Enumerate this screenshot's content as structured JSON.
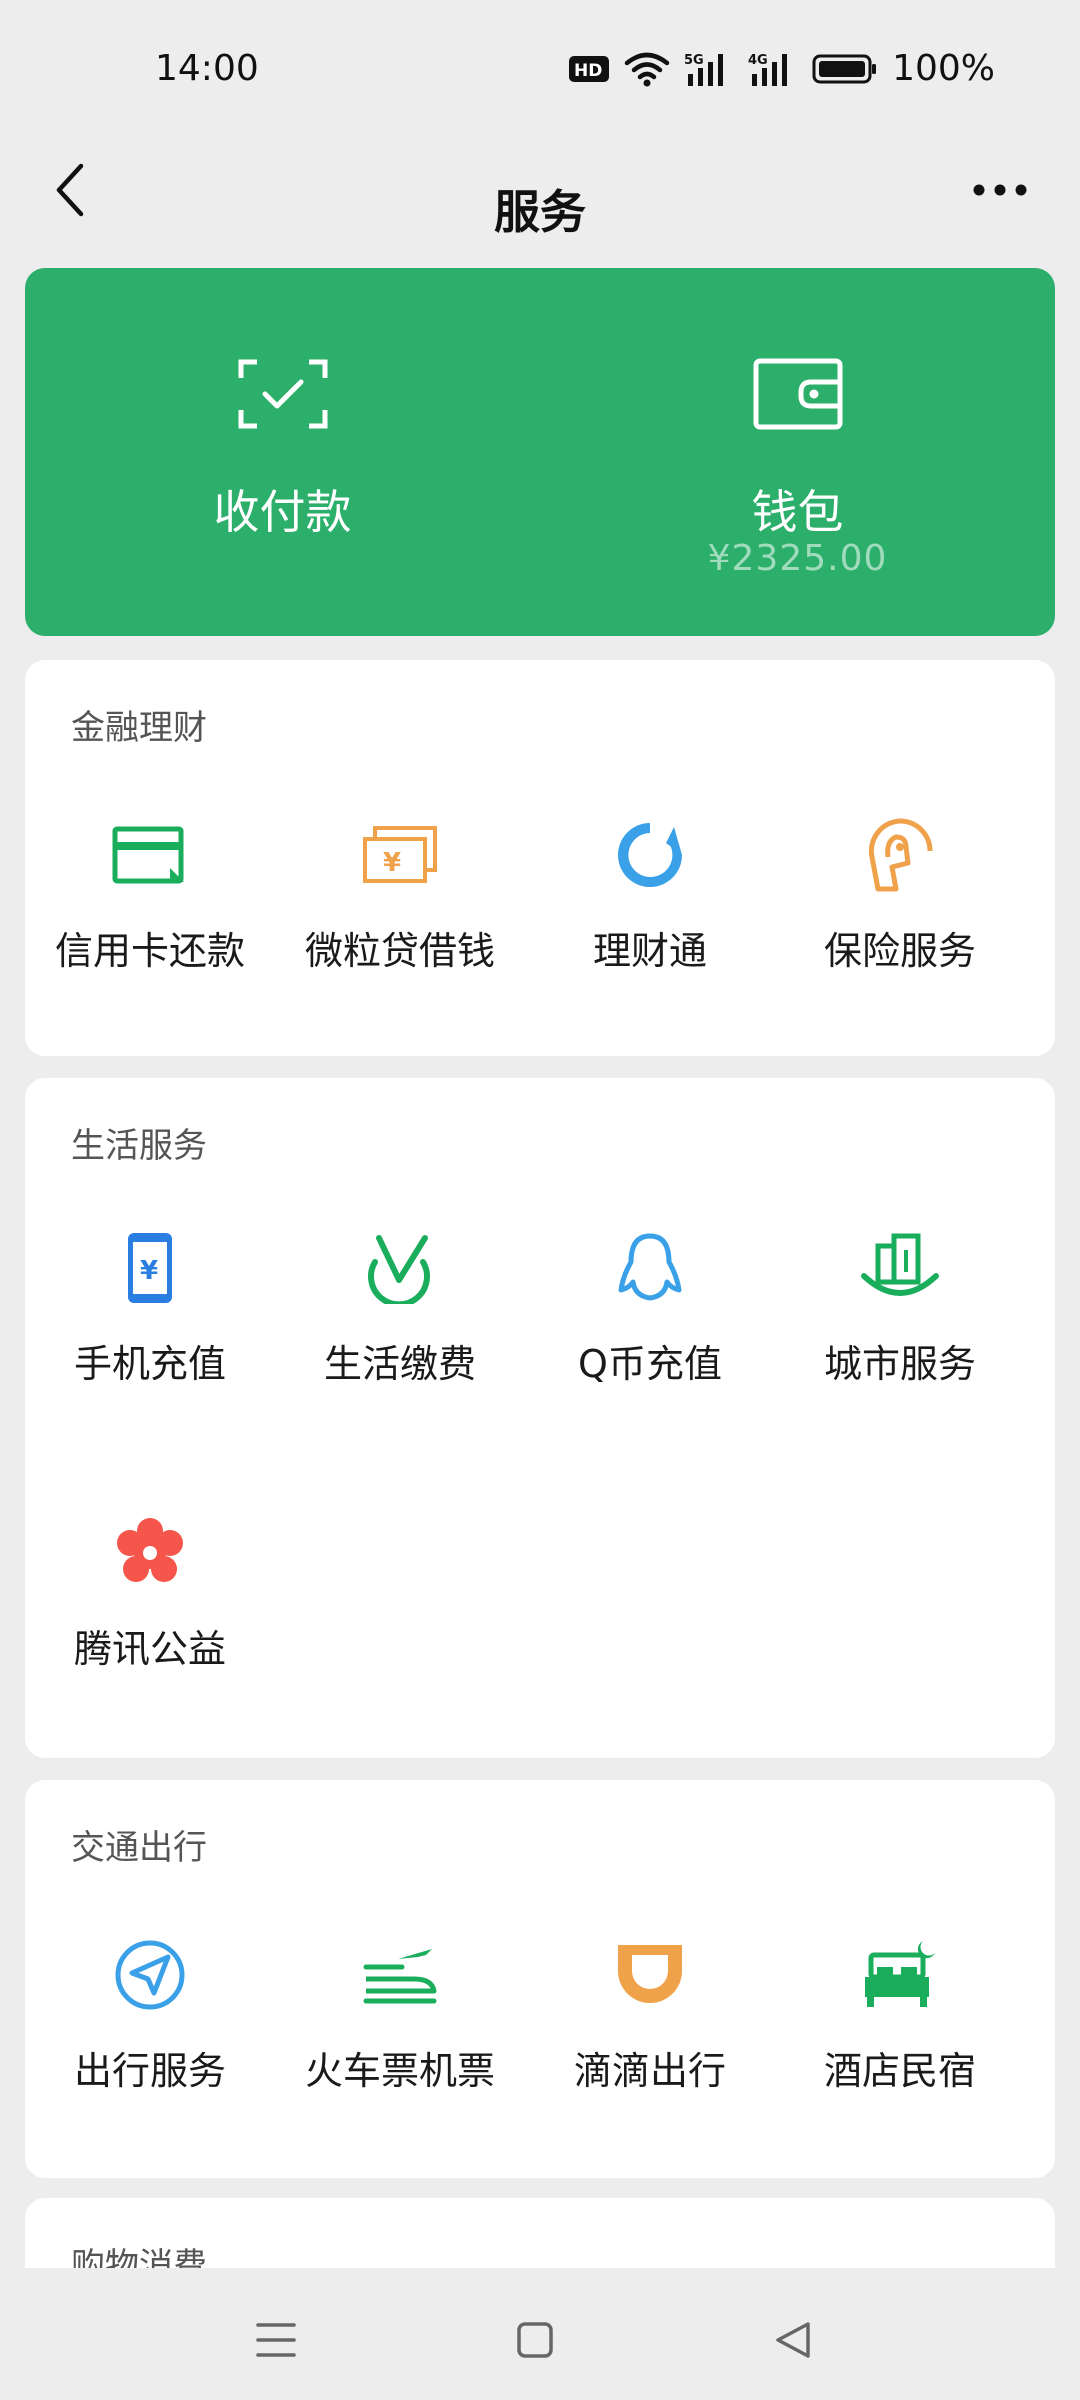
{
  "status": {
    "time": "14:00",
    "hd_label": "HD",
    "net5g": "5G",
    "net4g": "4G",
    "battery": "100%"
  },
  "header": {
    "title": "服务",
    "back_icon": "chevron-left-icon",
    "more_icon": "more-dots-icon"
  },
  "hero": {
    "pay": {
      "label": "收付款",
      "icon": "scan-check-icon"
    },
    "wallet": {
      "label": "钱包",
      "balance": "¥2325.00",
      "icon": "wallet-icon"
    },
    "color": "#2caf6a"
  },
  "finance": {
    "title": "金融理财",
    "items": [
      {
        "label": "信用卡还款",
        "icon": "credit-card-icon",
        "color": "#1aad5b"
      },
      {
        "label": "微粒贷借钱",
        "icon": "cash-icon",
        "color": "#f0a24a"
      },
      {
        "label": "理财通",
        "icon": "licaitong-icon",
        "color": "#3aa0e8"
      },
      {
        "label": "保险服务",
        "icon": "insurance-icon",
        "color": "#f0a24a"
      }
    ]
  },
  "life": {
    "title": "生活服务",
    "items": [
      {
        "label": "手机充值",
        "icon": "phone-recharge-icon",
        "color": "#2a7de1"
      },
      {
        "label": "生活缴费",
        "icon": "bill-payment-icon",
        "color": "#1aad5b"
      },
      {
        "label": "Q币充值",
        "icon": "qq-penguin-icon",
        "color": "#3aa0e8"
      },
      {
        "label": "城市服务",
        "icon": "city-building-icon",
        "color": "#1aad5b"
      },
      {
        "label": "腾讯公益",
        "icon": "charity-flower-icon",
        "color": "#f5554a"
      }
    ]
  },
  "travel": {
    "title": "交通出行",
    "items": [
      {
        "label": "出行服务",
        "icon": "navigation-arrow-icon",
        "color": "#3aa0e8"
      },
      {
        "label": "火车票机票",
        "icon": "train-plane-icon",
        "color": "#1aad5b"
      },
      {
        "label": "滴滴出行",
        "icon": "didi-icon",
        "color": "#f0a24a"
      },
      {
        "label": "酒店民宿",
        "icon": "hotel-bed-icon",
        "color": "#1aad5b"
      }
    ]
  },
  "shopping": {
    "title": "购物消费"
  },
  "bottom_nav": {
    "menu_icon": "menu-icon",
    "home_icon": "home-square-icon",
    "back_icon": "back-triangle-icon"
  }
}
